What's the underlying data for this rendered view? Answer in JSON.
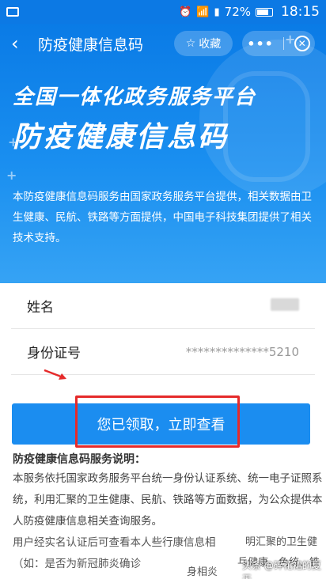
{
  "status_bar": {
    "battery": "72%",
    "time": "18:15"
  },
  "nav": {
    "title": "防疫健康信息码",
    "favorite_label": "收藏",
    "more_label": "•••"
  },
  "hero": {
    "subtitle": "全国一体化政务服务平台",
    "title": "防疫健康信息码",
    "description": "本防疫健康信息码服务由国家政务服务平台提供，相关数据由卫生健康、民航、铁路等方面提供，中国电子科技集团提供了相关技术支持。"
  },
  "form": {
    "name_label": "姓名",
    "id_label": "身份证号",
    "id_value": "**************5210"
  },
  "cta": {
    "label": "您已领取，立即查看"
  },
  "notes": {
    "heading": "防疫健康信息码服务说明：",
    "para1": "本服务依托国家政务服务平台统一身份认证系统、统一电子证照系统，利用汇聚的卫生健康、民航、铁路等方面数据，为公众提供本人防疫健康信息相关查询服务。",
    "para2": "用户经实名认证后可查看本人些行康信息相",
    "para3": "（如：是否为新冠肺炎确诊"
  },
  "overlay": {
    "line1": "明汇聚的卫生健",
    "line2": "身相炎",
    "line3": "乓健康、色统、铁"
  },
  "watermark": "头条 @碎花裙的夏天",
  "colors": {
    "primary": "#1b8df0",
    "highlight": "#e52a2a"
  }
}
